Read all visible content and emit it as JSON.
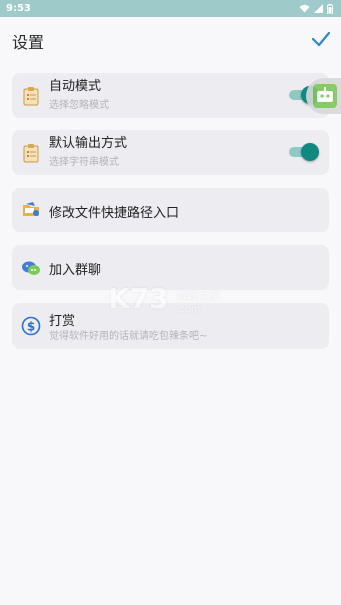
{
  "status_bar": {
    "time": "9:53",
    "icons": [
      "wifi-icon",
      "signal-icon",
      "battery-icon"
    ]
  },
  "app_bar": {
    "title": "设置",
    "confirm_icon": "check-icon"
  },
  "settings": [
    {
      "label": "自动模式",
      "subtitle": "选择忽略模式",
      "icon": "clipboard-icon",
      "switch": true,
      "enabled": true
    },
    {
      "label": "默认输出方式",
      "subtitle": "选择字符串模式",
      "icon": "clipboard-icon",
      "switch": true,
      "enabled": true
    },
    {
      "label": "修改文件快捷路径入口",
      "icon": "folder-shortcut-icon"
    },
    {
      "label": "加入群聊",
      "icon": "group-chat-icon"
    },
    {
      "label": "打赏",
      "subtitle": "觉得软件好用的话就请吃包辣条吧~",
      "icon": "dollar-icon"
    }
  ],
  "floating_button_icon": "robot-icon",
  "watermark": {
    "logo": "K73",
    "tagline": "游戏之家",
    "domain": ".com"
  },
  "colors": {
    "accent": "#11897e",
    "status_bar": "#9ecaca",
    "card": "#ececf1",
    "check": "#2f86c6"
  }
}
